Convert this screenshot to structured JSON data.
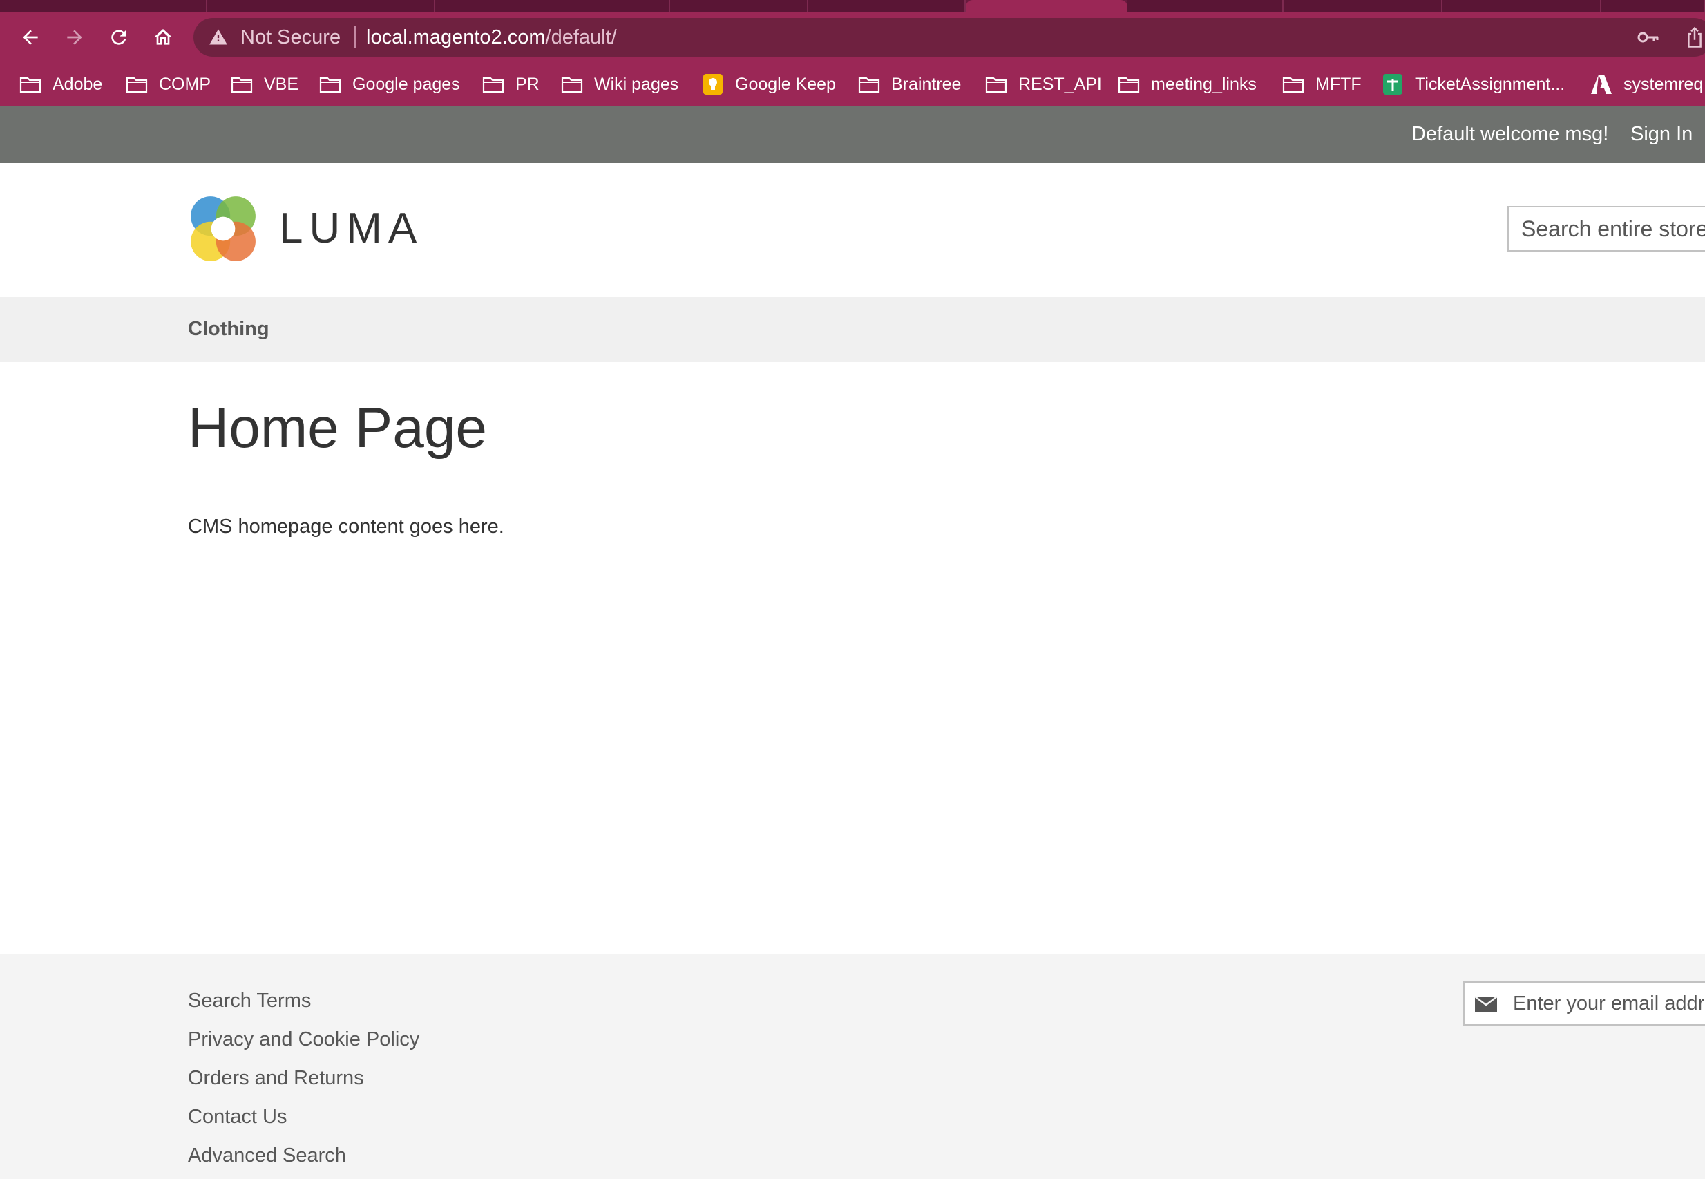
{
  "browser": {
    "omnibox": {
      "security_label": "Not Secure",
      "url_host": "local.magento2.com",
      "url_path": "/default/"
    },
    "bookmarks": [
      {
        "label": "Adobe",
        "icon": "folder-icon"
      },
      {
        "label": "COMP",
        "icon": "folder-icon"
      },
      {
        "label": "VBE",
        "icon": "folder-icon"
      },
      {
        "label": "Google pages",
        "icon": "folder-icon"
      },
      {
        "label": "PR",
        "icon": "folder-icon"
      },
      {
        "label": "Wiki pages",
        "icon": "folder-icon"
      },
      {
        "label": "Google Keep",
        "icon": "google-keep-icon"
      },
      {
        "label": "Braintree",
        "icon": "folder-icon"
      },
      {
        "label": "REST_API",
        "icon": "folder-icon"
      },
      {
        "label": "meeting_links",
        "icon": "folder-icon"
      },
      {
        "label": "MFTF",
        "icon": "folder-icon"
      },
      {
        "label": "TicketAssignment...",
        "icon": "google-sheets-icon"
      },
      {
        "label": "systemreq",
        "icon": "adobe-icon"
      }
    ]
  },
  "header": {
    "welcome_message": "Default welcome msg!",
    "sign_in_label": "Sign In",
    "logo_text": "LUMA",
    "search_placeholder": "Search entire store here..."
  },
  "navigation": {
    "items": [
      {
        "label": "Clothing"
      }
    ]
  },
  "main": {
    "page_title": "Home Page",
    "content_text": "CMS homepage content goes here."
  },
  "footer": {
    "links": [
      {
        "label": "Search Terms"
      },
      {
        "label": "Privacy and Cookie Policy"
      },
      {
        "label": "Orders and Returns"
      },
      {
        "label": "Contact Us"
      },
      {
        "label": "Advanced Search"
      }
    ],
    "newsletter_placeholder": "Enter your email address"
  },
  "colors": {
    "browser_accent": "#9b2756",
    "panel_header": "#6e716e",
    "nav_bar": "#f0f0f0",
    "footer_bg": "#f4f4f4"
  }
}
